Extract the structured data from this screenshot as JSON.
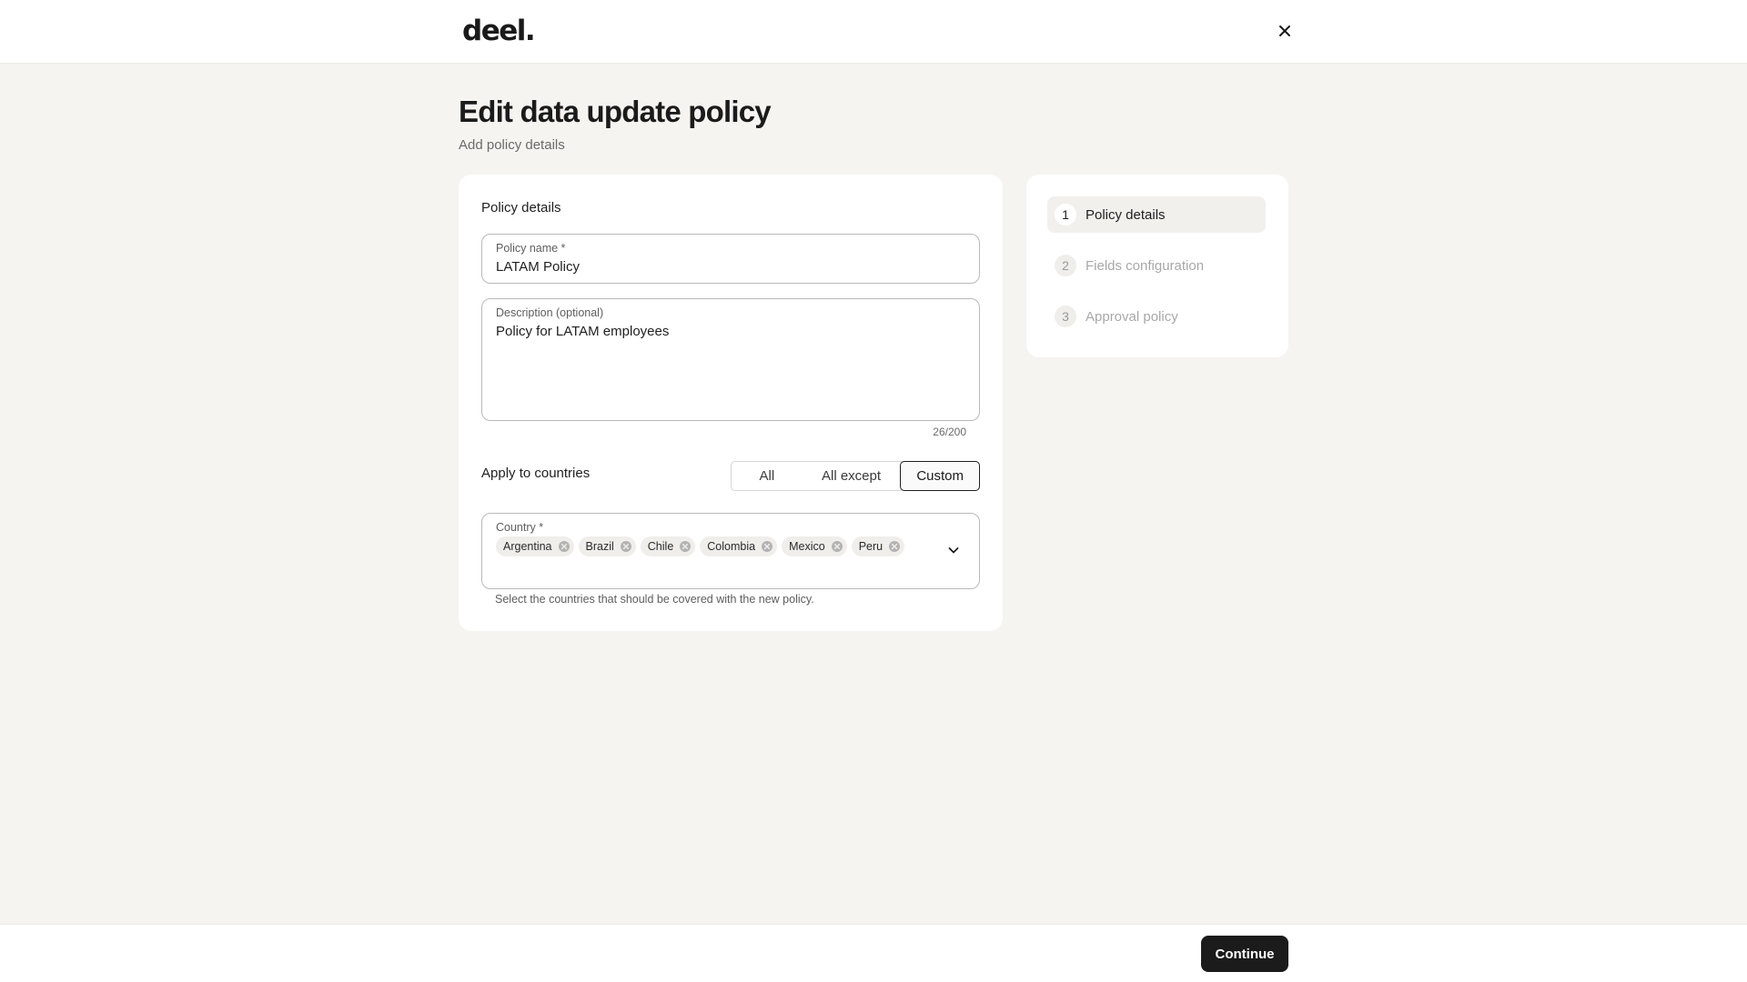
{
  "header": {
    "logo": "deel.",
    "close_icon": "close-icon"
  },
  "page": {
    "title": "Edit data update policy",
    "subtitle": "Add policy details"
  },
  "form": {
    "section_title": "Policy details",
    "policy_name": {
      "label": "Policy name *",
      "value": "LATAM Policy"
    },
    "description": {
      "label": "Description (optional)",
      "value": "Policy for LATAM employees",
      "char_count": "26/200"
    },
    "apply_to_countries": {
      "label": "Apply to countries",
      "options": [
        "All",
        "All except",
        "Custom"
      ],
      "selected": "Custom"
    },
    "country": {
      "label": "Country *",
      "selected": [
        "Argentina",
        "Brazil",
        "Chile",
        "Colombia",
        "Mexico",
        "Peru"
      ],
      "chip_remove_icon": "circle-x-icon",
      "dropdown_icon": "chevron-down-icon",
      "helper": "Select the countries that should be covered with the new policy."
    }
  },
  "stepper": {
    "steps": [
      {
        "number": "1",
        "label": "Policy details",
        "active": true
      },
      {
        "number": "2",
        "label": "Fields configuration",
        "active": false
      },
      {
        "number": "3",
        "label": "Approval policy",
        "active": false
      }
    ]
  },
  "footer": {
    "continue_label": "Continue"
  },
  "colors": {
    "background": "#f5f4f1",
    "card": "#ffffff",
    "primary_button": "#1b1b1b",
    "chip": "#efeeeb"
  }
}
